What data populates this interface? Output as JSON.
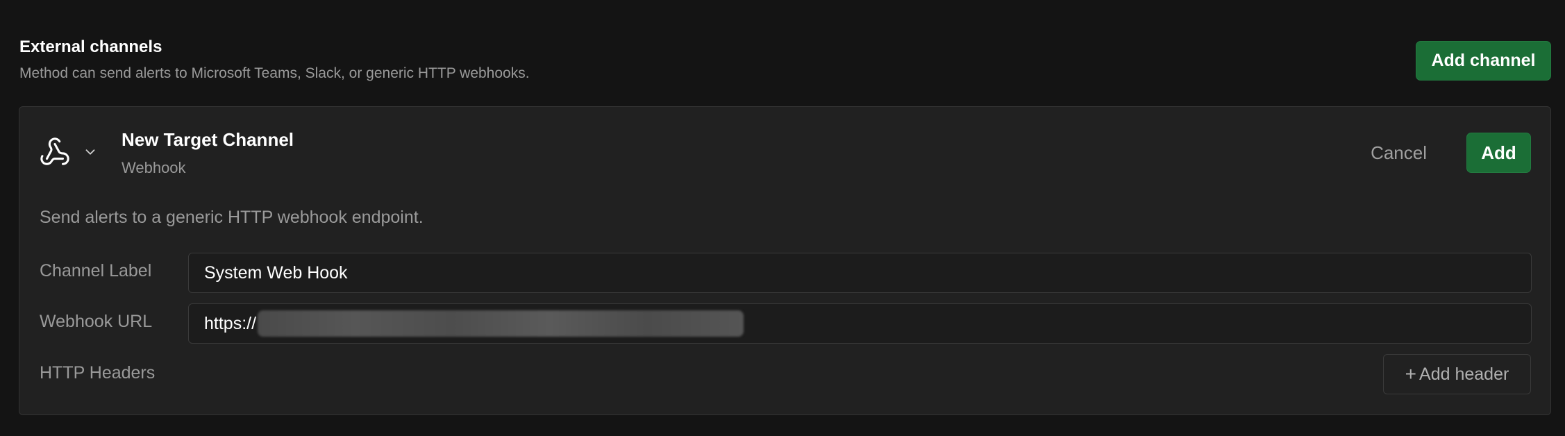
{
  "section": {
    "title": "External channels",
    "subtitle": "Method can send alerts to Microsoft Teams, Slack, or generic HTTP webhooks.",
    "add_channel_label": "Add channel"
  },
  "card": {
    "icon": "webhook-icon",
    "channel_name": "New Target Channel",
    "channel_type": "Webhook",
    "cancel_label": "Cancel",
    "add_label": "Add",
    "description": "Send alerts to a generic HTTP webhook endpoint.",
    "fields": {
      "channel_label": {
        "label": "Channel Label",
        "value": "System Web Hook"
      },
      "webhook_url": {
        "label": "Webhook URL",
        "value_prefix": "https://"
      },
      "http_headers": {
        "label": "HTTP Headers",
        "add_header_label": "Add header"
      }
    }
  },
  "colors": {
    "background": "#141414",
    "card": "#212121",
    "accent_green": "#1b6e36",
    "muted_text": "#9a9a9a"
  }
}
